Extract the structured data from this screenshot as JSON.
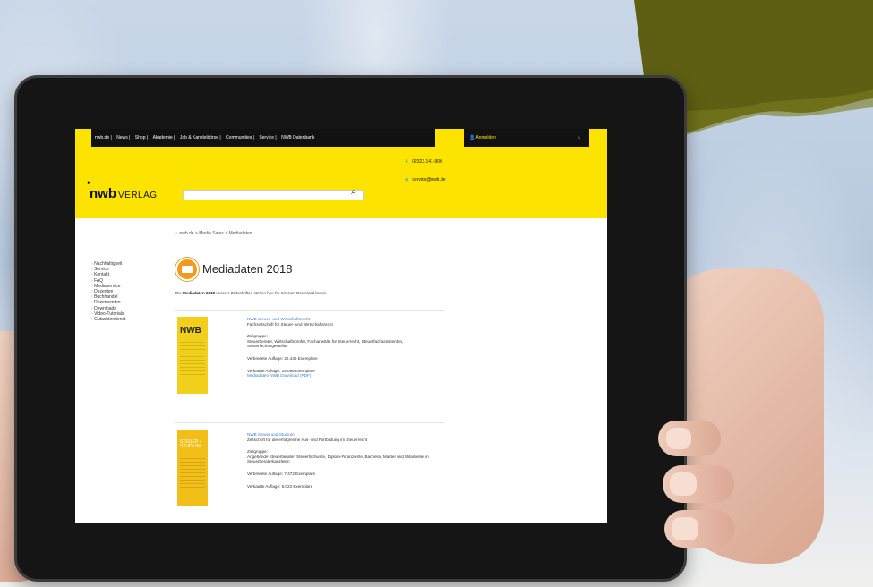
{
  "site": {
    "topnav": [
      "nwb.de",
      "News",
      "Shop",
      "Akademie",
      "Job & Kanzleibörse",
      "Communities",
      "Service",
      "NWB Datenbank"
    ],
    "login_label": "Anmelden",
    "logo_main": "nwb",
    "logo_sub": "VERLAG",
    "phone": "02323.141-900",
    "email": "service@nwb.de",
    "breadcrumb": "nwb.de > Media Sales > Mediadaten"
  },
  "sidebar": [
    "Nachhaltigkeit",
    "Service",
    "Kontakt",
    "FAQ",
    "Mediaservice",
    "Dozenten",
    "Buchhandel",
    "Rezensenten",
    "Downloads",
    "Video-Tutorials",
    "Gutachterdienst"
  ],
  "main": {
    "title": "Mediadaten 2018",
    "intro_bold": "Mediadaten 2018",
    "intro_pre": "Die ",
    "intro_rest": " unserer Zeitschriften stehen hier für Sie zum Download bereit.",
    "items": [
      {
        "cover_title": "NWB",
        "name": "NWB Steuer- und Wirtschaftsrecht",
        "desc": "Fachzeitschrift für Steuer- und Wirtschaftsrecht",
        "target_label": "Zielgruppe:",
        "target": "Steuerberater, Wirtschaftsprüfer, Fachanwälte für Steuerrecht, Steuerfachassistenten, Steuerfachangestellte.",
        "circulation": "Verbreitete Auflage: 26.438 Exemplare",
        "sold": "Verkaufte Auflage: 25.096 Exemplare",
        "download": "Mediadaten NWB Download (PDF)"
      },
      {
        "cover_title": "STEUER + STUDIUM",
        "name": "NWB Steuer und Studium",
        "desc": "Zeitschrift für die erfolgreiche Aus- und Fortbildung im Steuerrecht",
        "target_label": "Zielgruppe:",
        "target": "Angehende Steuerberater, Steuerfachwirte, Diplom-Finanzwirte, Bachelor, Master und Mitarbeiter in Steuerberaterkanzleien",
        "circulation": "Verbreitete Auflage: 7.472 Exemplare",
        "sold": "Verkaufte Auflage: 6.023 Exemplare"
      }
    ]
  },
  "colors": {
    "brand_yellow": "#fde400",
    "nav_dark": "#111111",
    "accent_orange": "#f29a1f",
    "corner_green": "#5e5f12"
  }
}
